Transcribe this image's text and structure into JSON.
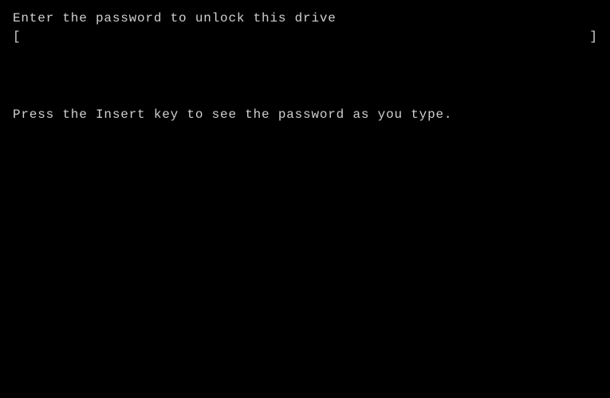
{
  "terminal": {
    "prompt_text": "Enter the password to unlock this drive",
    "bracket_left": "[",
    "bracket_right": "]",
    "hint_text": "Press the Insert key to see the password as you type.",
    "input_placeholder": ""
  }
}
